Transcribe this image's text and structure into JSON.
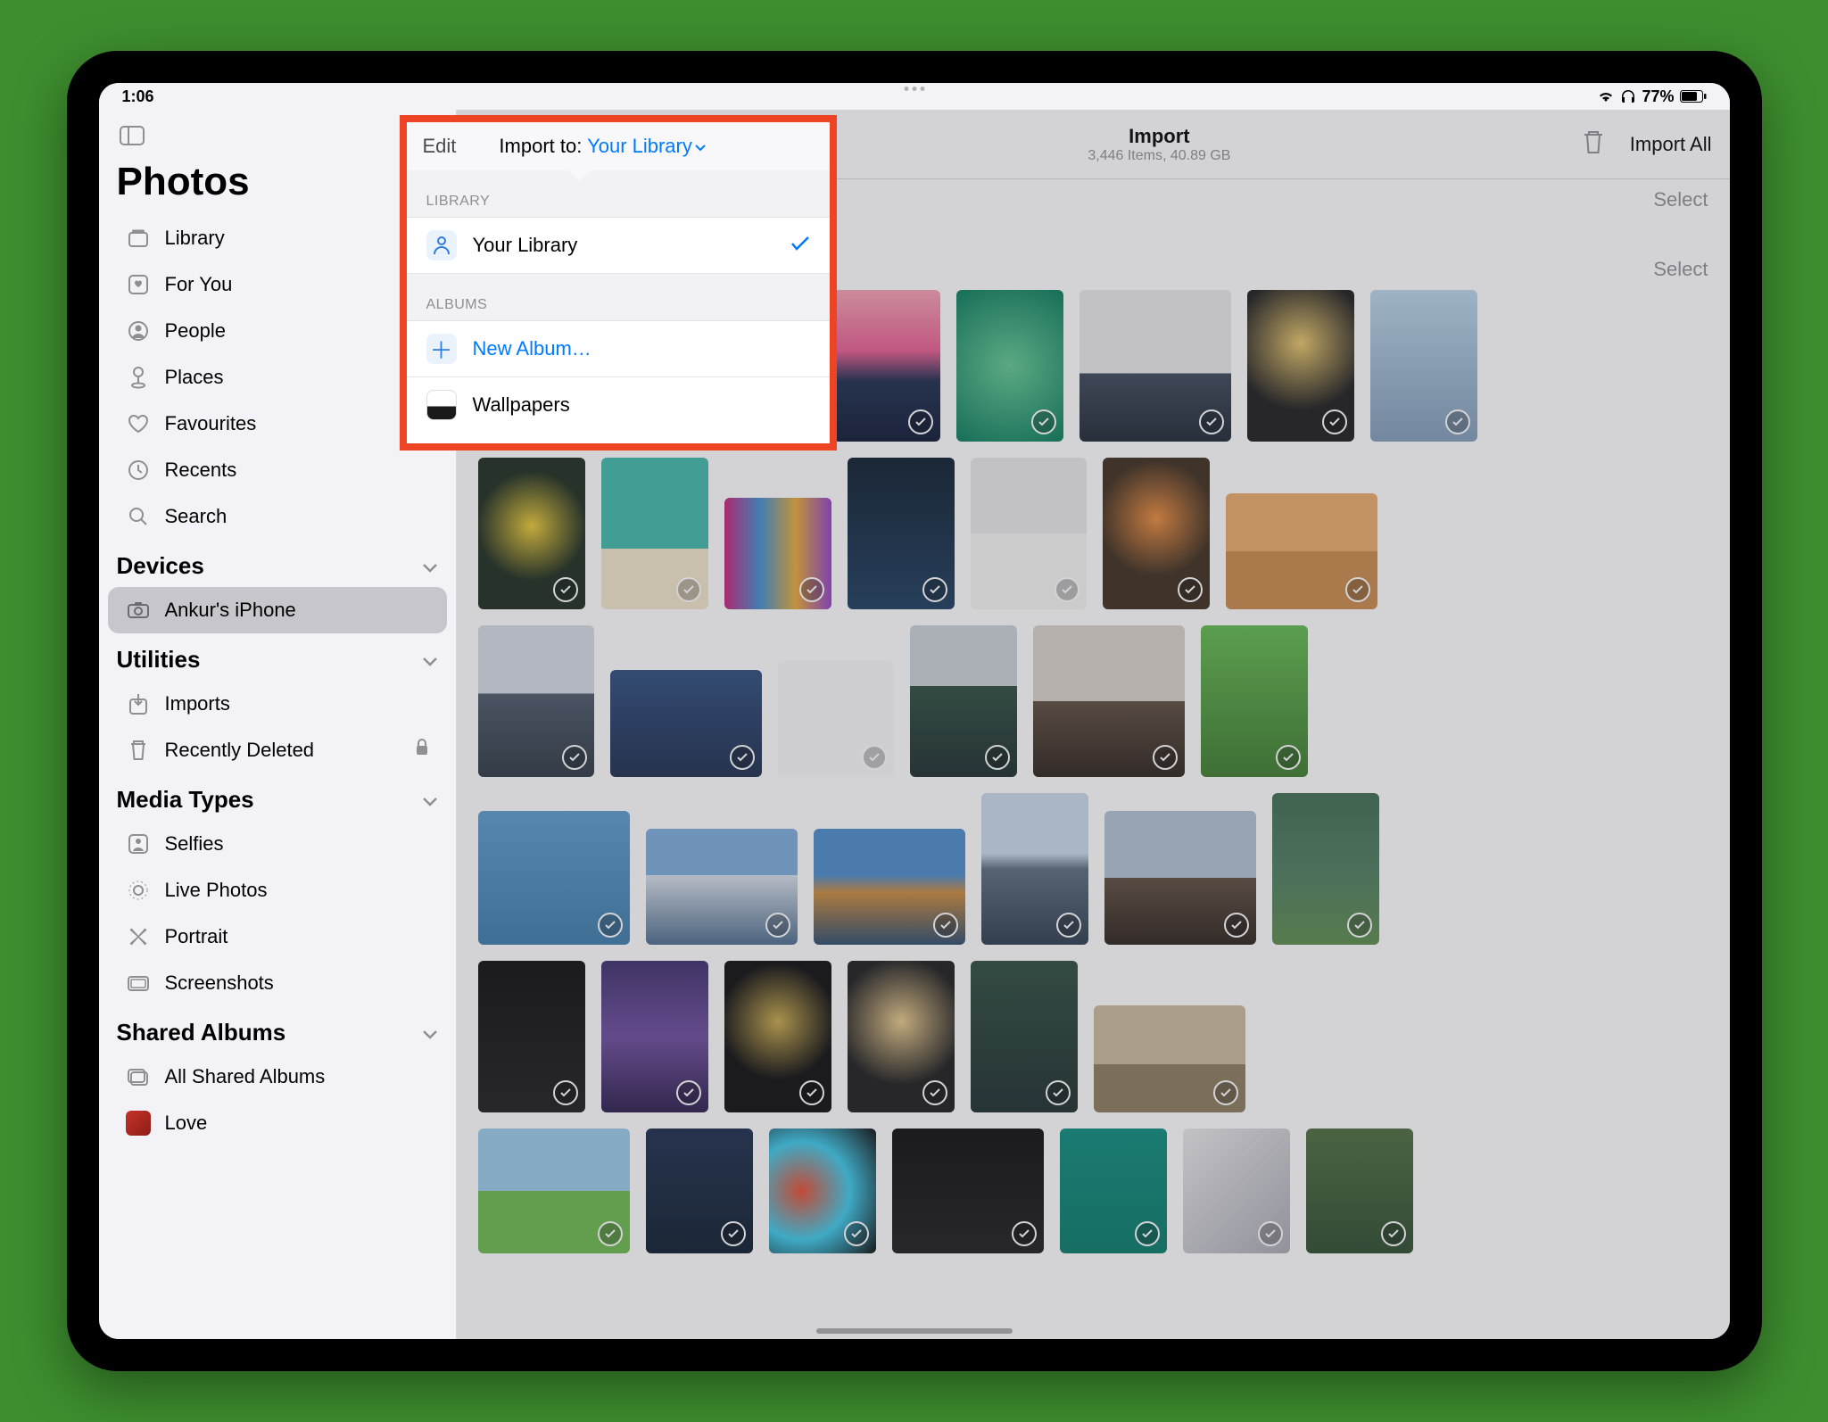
{
  "status": {
    "time": "1:06",
    "battery": "77%"
  },
  "sidebar": {
    "title": "Photos",
    "items": [
      {
        "icon": "library",
        "label": "Library"
      },
      {
        "icon": "foryou",
        "label": "For You"
      },
      {
        "icon": "people",
        "label": "People"
      },
      {
        "icon": "places",
        "label": "Places"
      },
      {
        "icon": "heart",
        "label": "Favourites"
      },
      {
        "icon": "clock",
        "label": "Recents"
      },
      {
        "icon": "search",
        "label": "Search"
      }
    ],
    "devices": {
      "title": "Devices",
      "items": [
        {
          "label": "Ankur's iPhone"
        }
      ]
    },
    "utilities": {
      "title": "Utilities",
      "items": [
        {
          "icon": "imports",
          "label": "Imports"
        },
        {
          "icon": "trash",
          "label": "Recently Deleted",
          "locked": true
        }
      ]
    },
    "media": {
      "title": "Media Types",
      "items": [
        {
          "icon": "selfies",
          "label": "Selfies"
        },
        {
          "icon": "live",
          "label": "Live Photos"
        },
        {
          "icon": "portrait",
          "label": "Portrait"
        },
        {
          "icon": "screenshots",
          "label": "Screenshots"
        }
      ]
    },
    "shared": {
      "title": "Shared Albums",
      "items": [
        {
          "icon": "allshared",
          "label": "All Shared Albums"
        },
        {
          "icon": "album",
          "label": "Love"
        }
      ]
    }
  },
  "toolbar": {
    "edit": "Edit",
    "import_to_label": "Import to:",
    "import_to_target": "Your Library",
    "title": "Import",
    "subtitle": "3,446 Items, 40.89 GB",
    "import_all": "Import All"
  },
  "section_actions": {
    "select1": "Select",
    "select2": "Select"
  },
  "popover": {
    "library_label": "LIBRARY",
    "your_library": "Your Library",
    "albums_label": "ALBUMS",
    "new_album": "New Album…",
    "wallpapers": "Wallpapers"
  }
}
